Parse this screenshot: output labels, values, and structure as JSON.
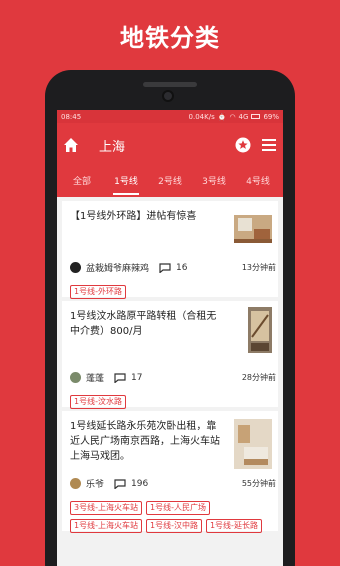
{
  "headline": "地铁分类",
  "statusbar": {
    "time": "08:45",
    "net_speed": "0.04K/s",
    "signal": "4G",
    "battery": "69%"
  },
  "appbar": {
    "city": "上海"
  },
  "tabs": [
    {
      "label": "全部"
    },
    {
      "label": "1号线"
    },
    {
      "label": "2号线"
    },
    {
      "label": "3号线"
    },
    {
      "label": "4号线"
    }
  ],
  "posts": [
    {
      "title": "【1号线外环路】进帖有惊喜",
      "author": "盆栽姆爷麻辣鸡",
      "comments": "16",
      "time": "13分钟前",
      "tags": [
        "1号线-外环路"
      ]
    },
    {
      "title": "1号线汶水路原平路转租（合租无中介费）800/月",
      "author": "蓬蓬",
      "comments": "17",
      "time": "28分钟前",
      "tags": [
        "1号线-汶水路"
      ]
    },
    {
      "title": "1号线延长路永乐苑次卧出租，靠近人民广场南京西路，上海火车站上海马戏团。",
      "author": "乐爷",
      "comments": "196",
      "time": "55分钟前",
      "tags": [
        "3号线-上海火车站",
        "1号线-人民广场",
        "1号线-上海火车站",
        "1号线-汉中路",
        "1号线-延长路"
      ]
    }
  ]
}
